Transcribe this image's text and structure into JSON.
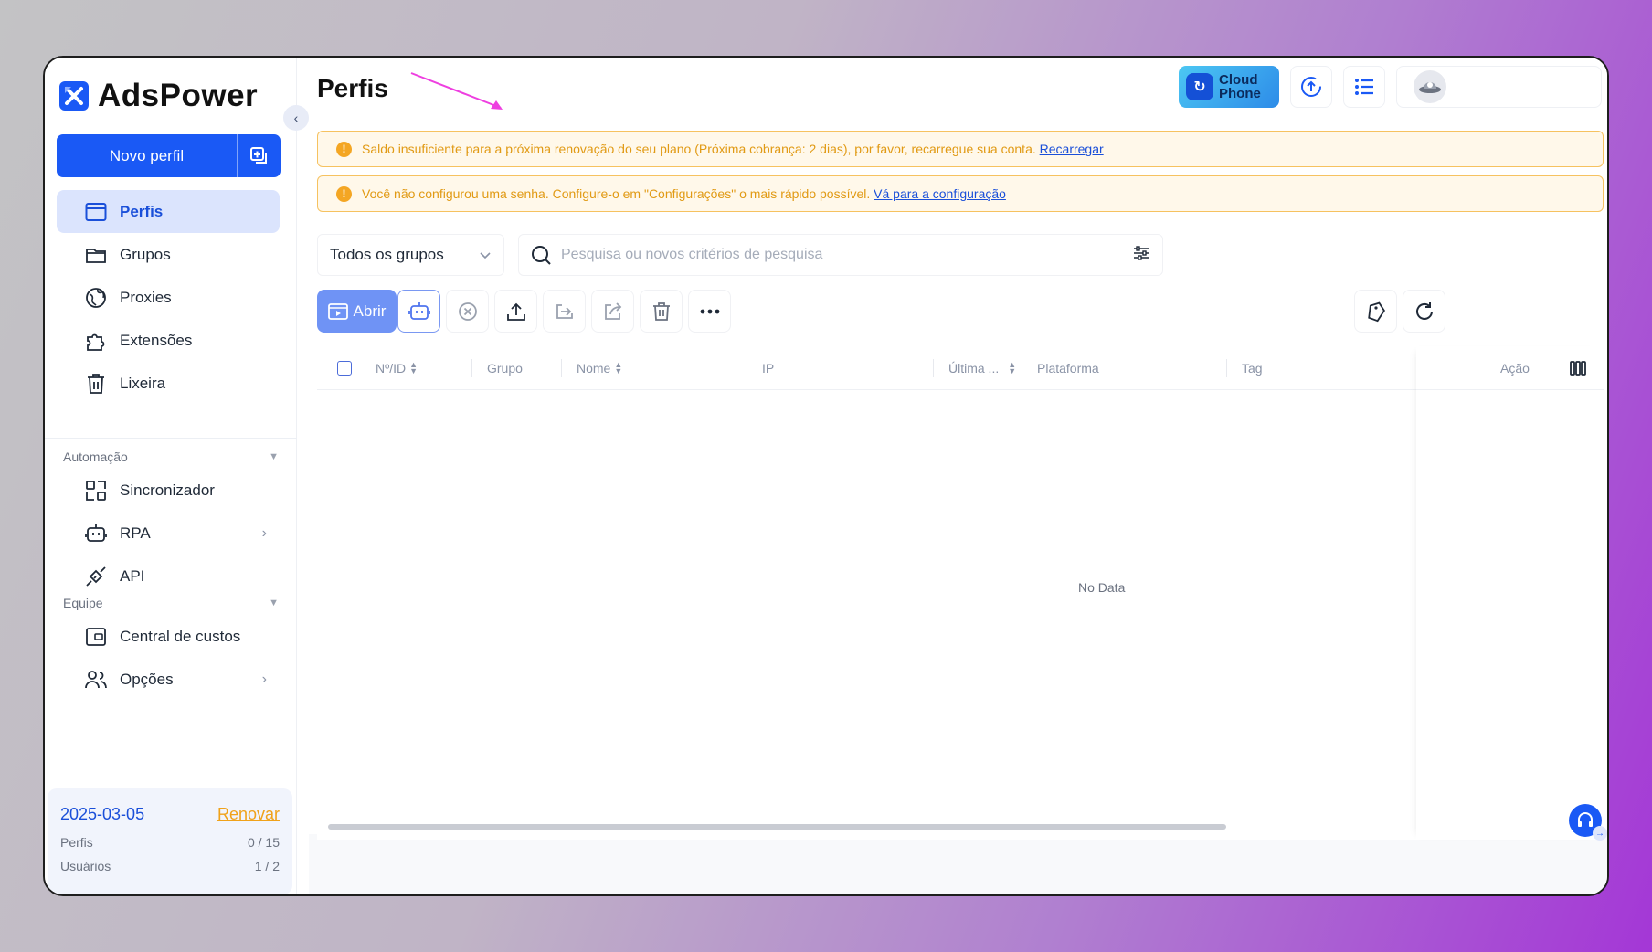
{
  "app": {
    "name": "AdsPower"
  },
  "sidebar": {
    "new_profile_label": "Novo perfil",
    "items": [
      {
        "label": "Perfis",
        "icon": "profiles-icon",
        "active": true
      },
      {
        "label": "Grupos",
        "icon": "folder-icon"
      },
      {
        "label": "Proxies",
        "icon": "globe-icon"
      },
      {
        "label": "Extensões",
        "icon": "puzzle-icon"
      },
      {
        "label": "Lixeira",
        "icon": "trash-icon"
      }
    ],
    "automation": {
      "title": "Automação",
      "items": [
        {
          "label": "Sincronizador",
          "icon": "sync-icon"
        },
        {
          "label": "RPA",
          "icon": "robot-icon"
        },
        {
          "label": "API",
          "icon": "plug-icon"
        }
      ]
    },
    "team": {
      "title": "Equipe",
      "items": [
        {
          "label": "Central de custos",
          "icon": "wallet-icon"
        },
        {
          "label": "Opções",
          "icon": "users-icon"
        }
      ]
    },
    "plan": {
      "date": "2025-03-05",
      "renew": "Renovar",
      "rows": [
        {
          "label": "Perfis",
          "value": "0 / 15"
        },
        {
          "label": "Usuários",
          "value": "1 / 2"
        }
      ]
    }
  },
  "header": {
    "title": "Perfis",
    "cloud_phone_line1": "Cloud",
    "cloud_phone_line2": "Phone"
  },
  "alerts": [
    {
      "text": "Saldo insuficiente para a próxima renovação do seu plano (Próxima cobrança: 2 dias), por favor, recarregue sua conta.",
      "link": "Recarregar"
    },
    {
      "text": "Você não configurou uma senha. Configure-o em \"Configurações\" o mais rápido possível.",
      "link": "Vá para a configuração"
    }
  ],
  "filters": {
    "group_select": "Todos os grupos",
    "search_placeholder": "Pesquisa ou novos critérios de pesquisa"
  },
  "toolbar": {
    "open_label": "Abrir"
  },
  "table": {
    "columns": [
      "Nº/ID",
      "Grupo",
      "Nome",
      "IP",
      "Última ...",
      "Plataforma",
      "Tag",
      "Ação"
    ],
    "empty_text": "No Data"
  },
  "colors": {
    "accent": "#1a59f5",
    "warning": "#f4a623",
    "active_bg": "#dbe4fd"
  }
}
